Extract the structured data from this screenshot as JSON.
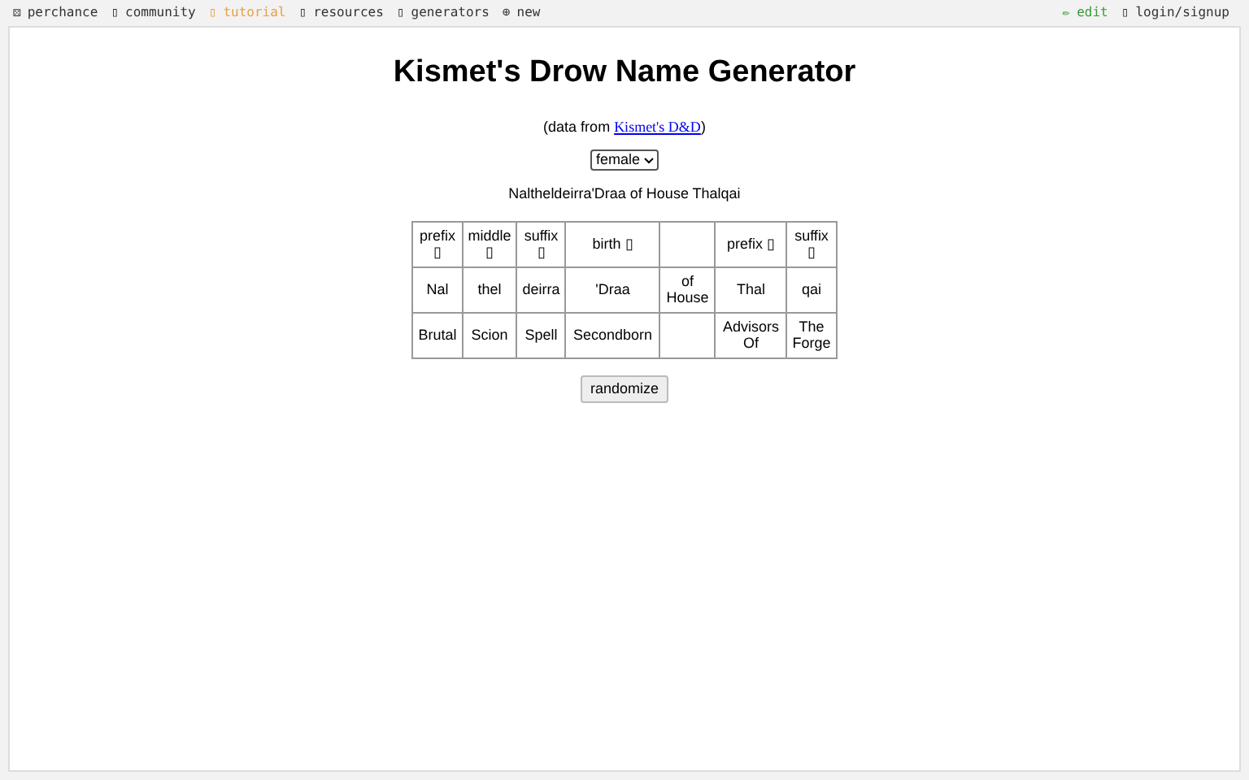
{
  "nav": {
    "left": [
      {
        "icon": "⚄",
        "label": "perchance",
        "kind": "plain"
      },
      {
        "icon": "▯",
        "label": "community",
        "kind": "plain"
      },
      {
        "icon": "▯",
        "label": "tutorial",
        "kind": "highlight"
      },
      {
        "icon": "▯",
        "label": "resources",
        "kind": "plain"
      },
      {
        "icon": "▯",
        "label": "generators",
        "kind": "plain"
      },
      {
        "icon": "⊕",
        "label": "new",
        "kind": "plain"
      }
    ],
    "right": [
      {
        "icon": "✏",
        "label": "edit",
        "kind": "green"
      },
      {
        "icon": "▯",
        "label": "login/signup",
        "kind": "plain"
      }
    ]
  },
  "title": "Kismet's Drow Name Generator",
  "credit": {
    "before": "(data from ",
    "link": "Kismet's D&D",
    "after": ")"
  },
  "gender_select": {
    "value": "female"
  },
  "result": "Naltheldeirra'Draa of House Thalqai",
  "table": {
    "rows": [
      [
        "prefix ▯",
        "middle ▯",
        "suffix ▯",
        "birth ▯",
        "",
        "prefix ▯",
        "suffix ▯"
      ],
      [
        "Nal",
        "thel",
        "deirra",
        "'Draa",
        "of House",
        "Thal",
        "qai"
      ],
      [
        "Brutal",
        "Scion",
        "Spell",
        "Secondborn",
        "",
        "Advisors Of",
        "The Forge"
      ]
    ]
  },
  "randomize_button": "randomize"
}
